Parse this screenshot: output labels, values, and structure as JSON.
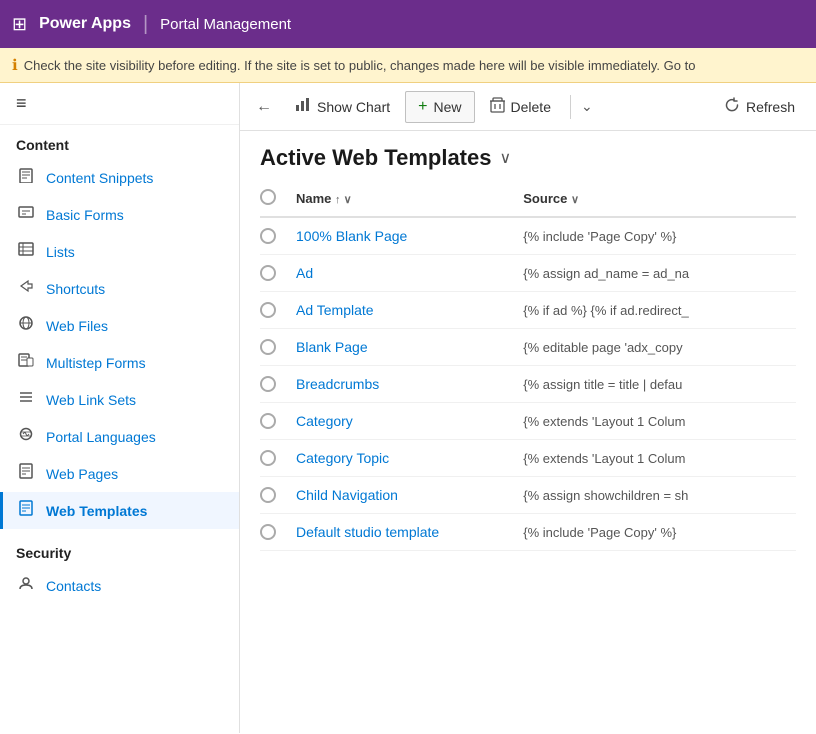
{
  "header": {
    "grid_icon": "⊞",
    "app_name": "Power Apps",
    "divider": "|",
    "module_name": "Portal Management"
  },
  "warning": {
    "icon": "ℹ",
    "text": "Check the site visibility before editing. If the site is set to public, changes made here will be visible immediately. Go to"
  },
  "sidebar": {
    "hamburger": "≡",
    "content_label": "Content",
    "items": [
      {
        "id": "content-snippets",
        "icon": "📄",
        "label": "Content Snippets",
        "active": false
      },
      {
        "id": "basic-forms",
        "icon": "📋",
        "label": "Basic Forms",
        "active": false
      },
      {
        "id": "lists",
        "icon": "📊",
        "label": "Lists",
        "active": false
      },
      {
        "id": "shortcuts",
        "icon": "↗",
        "label": "Shortcuts",
        "active": false
      },
      {
        "id": "web-files",
        "icon": "🌐",
        "label": "Web Files",
        "active": false
      },
      {
        "id": "multistep-forms",
        "icon": "📝",
        "label": "Multistep Forms",
        "active": false
      },
      {
        "id": "web-link-sets",
        "icon": "≡",
        "label": "Web Link Sets",
        "active": false
      },
      {
        "id": "portal-languages",
        "icon": "🔗",
        "label": "Portal Languages",
        "active": false
      },
      {
        "id": "web-pages",
        "icon": "📄",
        "label": "Web Pages",
        "active": false
      },
      {
        "id": "web-templates",
        "icon": "📄",
        "label": "Web Templates",
        "active": true
      }
    ],
    "security_label": "Security",
    "security_items": [
      {
        "id": "contacts",
        "icon": "👤",
        "label": "Contacts",
        "active": false
      }
    ]
  },
  "toolbar": {
    "back_icon": "←",
    "show_chart_icon": "📊",
    "show_chart_label": "Show Chart",
    "new_icon": "+",
    "new_label": "New",
    "delete_icon": "🗑",
    "delete_label": "Delete",
    "chevron_icon": "⌄",
    "refresh_icon": "↻",
    "refresh_label": "Refresh"
  },
  "page_title": {
    "title": "Active Web Templates",
    "chevron": "∨"
  },
  "table": {
    "columns": [
      {
        "id": "name",
        "label": "Name",
        "sort": "↑ ∨"
      },
      {
        "id": "source",
        "label": "Source",
        "sort": "∨"
      }
    ],
    "rows": [
      {
        "name": "100% Blank Page",
        "source": "{% include 'Page Copy' %}"
      },
      {
        "name": "Ad",
        "source": "{% assign ad_name = ad_na"
      },
      {
        "name": "Ad Template",
        "source": "{% if ad %} {% if ad.redirect_"
      },
      {
        "name": "Blank Page",
        "source": "{% editable page 'adx_copy"
      },
      {
        "name": "Breadcrumbs",
        "source": "{% assign title = title | defau"
      },
      {
        "name": "Category",
        "source": "{% extends 'Layout 1 Colum"
      },
      {
        "name": "Category Topic",
        "source": "{% extends 'Layout 1 Colum"
      },
      {
        "name": "Child Navigation",
        "source": "{% assign showchildren = sh"
      },
      {
        "name": "Default studio template",
        "source": "{% include 'Page Copy' %}"
      }
    ]
  }
}
